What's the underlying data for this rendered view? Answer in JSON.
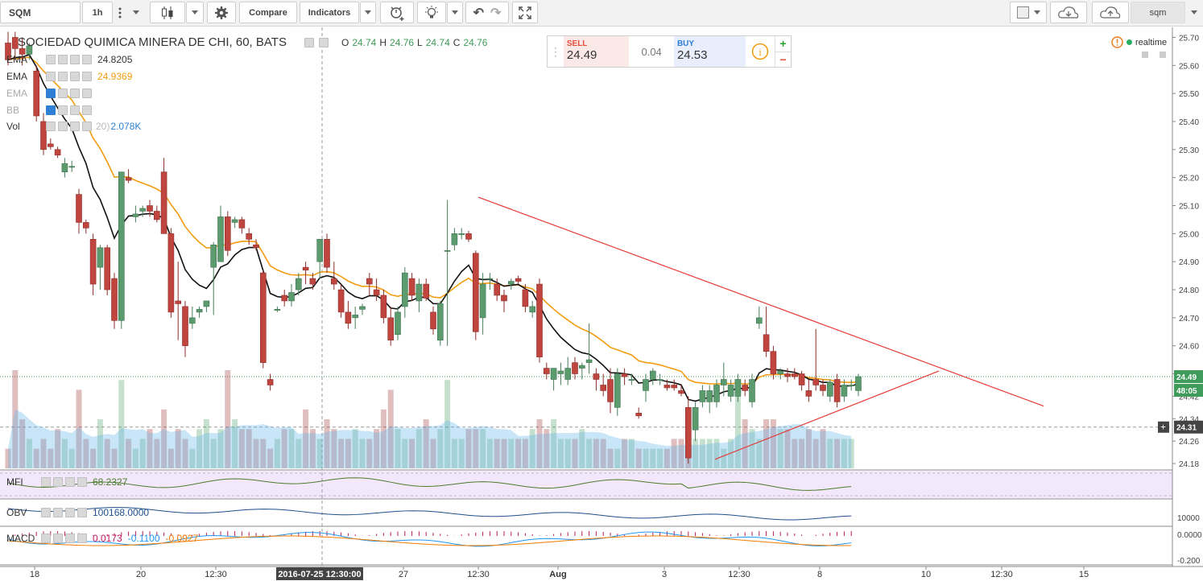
{
  "toolbar": {
    "symbol": "SQM",
    "interval": "1h",
    "compare_label": "Compare",
    "indicators_label": "Indicators",
    "right_symbol": "sqm"
  },
  "chart_header": {
    "title": "SOCIEDAD QUIMICA MINERA DE CHI, 60, BATS",
    "o_label": "O",
    "o": "24.74",
    "h_label": "H",
    "h": "24.76",
    "l_label": "L",
    "l": "24.74",
    "c_label": "C",
    "c": "24.76"
  },
  "studies": [
    {
      "name": "EMA",
      "value": "24.8205",
      "color": "#333333"
    },
    {
      "name": "EMA",
      "value": "24.9369",
      "color": "#f39c12"
    },
    {
      "name": "EMA",
      "value": "",
      "color": "#999999"
    },
    {
      "name": "BB",
      "value": "",
      "color": "#999999"
    },
    {
      "name": "Vol",
      "value": "2.078K",
      "color": "#2f7fd4",
      "faded": "20)"
    }
  ],
  "trade_panel": {
    "sell_label": "SELL",
    "sell_price": "24.49",
    "spread": "0.04",
    "buy_label": "BUY",
    "buy_price": "24.53",
    "plus": "+",
    "minus": "−"
  },
  "realtime_label": "realtime",
  "price_axis": {
    "ticks": [
      "25.70",
      "25.60",
      "25.50",
      "25.40",
      "25.30",
      "25.20",
      "25.10",
      "25.00",
      "24.90",
      "24.80",
      "24.70",
      "24.60",
      "24.50",
      "24.42",
      "24.34",
      "24.26",
      "24.18"
    ],
    "current_price": "24.49",
    "countdown": "48:05",
    "crosshair_price": "24.31"
  },
  "time_axis": {
    "ticks": [
      "18",
      "20",
      "12:30",
      "27",
      "12:30",
      "Aug",
      "3",
      "12:30",
      "8",
      "10",
      "12:30",
      "15"
    ],
    "crosshair_label": "2016-07-25 12:30:00"
  },
  "mfi": {
    "name": "MFI",
    "value": "68.2327",
    "color": "#4a7d2a"
  },
  "obv": {
    "name": "OBV",
    "value": "100168.0000",
    "axis_label": "10000",
    "color": "#1f4e8c"
  },
  "macd": {
    "name": "MACD",
    "hist": "0.0173",
    "macd": "-0.1100",
    "signal": "-0.0927",
    "axis_top": "0.0000",
    "axis_bottom": "-0.200"
  },
  "chart_data": {
    "type": "candlestick",
    "ylim": [
      24.16,
      25.73
    ],
    "candles": [
      [
        25.68,
        25.72,
        25.6,
        25.62
      ],
      [
        25.7,
        25.72,
        25.62,
        25.66
      ],
      [
        25.66,
        25.7,
        25.6,
        25.64
      ],
      [
        25.64,
        25.68,
        25.62,
        25.67
      ],
      [
        25.58,
        25.6,
        25.4,
        25.42
      ],
      [
        25.4,
        25.43,
        25.28,
        25.3
      ],
      [
        25.32,
        25.34,
        25.3,
        25.31
      ],
      [
        25.3,
        25.31,
        25.27,
        25.28
      ],
      [
        25.22,
        25.27,
        25.2,
        25.25
      ],
      [
        25.24,
        25.26,
        25.22,
        25.24
      ],
      [
        25.14,
        25.16,
        25.0,
        25.04
      ],
      [
        25.04,
        25.05,
        25.0,
        25.02
      ],
      [
        24.98,
        25.0,
        24.78,
        24.82
      ],
      [
        24.88,
        24.96,
        24.8,
        24.95
      ],
      [
        24.95,
        24.96,
        24.78,
        24.8
      ],
      [
        24.84,
        24.86,
        24.66,
        24.69
      ],
      [
        24.69,
        25.22,
        24.66,
        25.22
      ],
      [
        25.2,
        25.23,
        25.18,
        25.19
      ],
      [
        25.06,
        25.1,
        25.04,
        25.07
      ],
      [
        25.08,
        25.1,
        25.06,
        25.09
      ],
      [
        25.1,
        25.12,
        25.06,
        25.08
      ],
      [
        25.08,
        25.1,
        25.04,
        25.05
      ],
      [
        25.22,
        25.27,
        25.0,
        25.0
      ],
      [
        25.0,
        25.02,
        24.7,
        24.72
      ],
      [
        24.76,
        24.9,
        24.62,
        24.75
      ],
      [
        24.74,
        24.76,
        24.56,
        24.6
      ],
      [
        24.68,
        24.74,
        24.66,
        24.7
      ],
      [
        24.72,
        24.74,
        24.7,
        24.73
      ],
      [
        24.74,
        24.76,
        24.72,
        24.76
      ],
      [
        24.88,
        24.97,
        24.71,
        24.96
      ],
      [
        24.9,
        25.1,
        24.9,
        25.06
      ],
      [
        25.06,
        25.08,
        24.92,
        24.94
      ],
      [
        25.04,
        25.06,
        25.02,
        25.05
      ],
      [
        25.05,
        25.06,
        25.0,
        25.02
      ],
      [
        25.0,
        25.02,
        24.96,
        24.98
      ],
      [
        24.96,
        24.98,
        24.94,
        24.95
      ],
      [
        24.86,
        24.87,
        24.52,
        24.54
      ],
      [
        24.48,
        24.5,
        24.44,
        24.46
      ],
      [
        24.73,
        24.74,
        24.72,
        24.73
      ],
      [
        24.78,
        24.8,
        24.74,
        24.76
      ],
      [
        24.76,
        24.82,
        24.74,
        24.79
      ],
      [
        24.8,
        24.86,
        24.78,
        24.84
      ],
      [
        24.88,
        24.9,
        24.82,
        24.87
      ],
      [
        24.84,
        24.86,
        24.8,
        24.82
      ],
      [
        24.9,
        24.98,
        24.84,
        24.98
      ],
      [
        24.98,
        25.0,
        24.86,
        24.88
      ],
      [
        24.84,
        24.9,
        24.8,
        24.82
      ],
      [
        24.8,
        24.82,
        24.7,
        24.72
      ],
      [
        24.72,
        24.76,
        24.66,
        24.68
      ],
      [
        24.7,
        24.74,
        24.66,
        24.71
      ],
      [
        24.73,
        24.75,
        24.71,
        24.74
      ],
      [
        24.84,
        24.86,
        24.78,
        24.82
      ],
      [
        24.8,
        24.84,
        24.76,
        24.78
      ],
      [
        24.78,
        24.8,
        24.68,
        24.7
      ],
      [
        24.7,
        24.74,
        24.6,
        24.62
      ],
      [
        24.64,
        24.74,
        24.62,
        24.72
      ],
      [
        24.74,
        24.88,
        24.7,
        24.86
      ],
      [
        24.84,
        24.86,
        24.76,
        24.78
      ],
      [
        24.76,
        24.84,
        24.72,
        24.82
      ],
      [
        24.82,
        24.84,
        24.76,
        24.77
      ],
      [
        24.72,
        24.74,
        24.64,
        24.66
      ],
      [
        24.62,
        24.76,
        24.6,
        24.75
      ],
      [
        24.94,
        25.12,
        24.6,
        24.94
      ],
      [
        24.96,
        25.02,
        24.94,
        25.0
      ],
      [
        25.0,
        25.02,
        24.98,
        25.0
      ],
      [
        25.0,
        25.01,
        24.97,
        24.98
      ],
      [
        24.93,
        24.94,
        24.62,
        24.65
      ],
      [
        24.7,
        24.86,
        24.64,
        24.82
      ],
      [
        24.84,
        24.86,
        24.8,
        24.84
      ],
      [
        24.82,
        24.84,
        24.76,
        24.78
      ],
      [
        24.78,
        24.8,
        24.72,
        24.76
      ],
      [
        24.82,
        24.84,
        24.8,
        24.83
      ],
      [
        24.84,
        24.85,
        24.82,
        24.83
      ],
      [
        24.8,
        24.82,
        24.72,
        24.74
      ],
      [
        24.72,
        24.76,
        24.7,
        24.74
      ],
      [
        24.82,
        24.84,
        24.54,
        24.56
      ],
      [
        24.52,
        24.54,
        24.48,
        24.5
      ],
      [
        24.48,
        24.52,
        24.44,
        24.52
      ],
      [
        24.5,
        24.54,
        24.46,
        24.51
      ],
      [
        24.48,
        24.56,
        24.46,
        24.52
      ],
      [
        24.54,
        24.56,
        24.48,
        24.5
      ],
      [
        24.52,
        24.54,
        24.48,
        24.53
      ],
      [
        24.54,
        24.68,
        24.5,
        24.55
      ],
      [
        24.5,
        24.52,
        24.44,
        24.48
      ],
      [
        24.46,
        24.5,
        24.42,
        24.44
      ],
      [
        24.48,
        24.52,
        24.36,
        24.4
      ],
      [
        24.38,
        24.52,
        24.35,
        24.5
      ],
      [
        24.5,
        24.52,
        24.46,
        24.49
      ],
      [
        24.48,
        24.5,
        24.46,
        24.48
      ],
      [
        24.36,
        24.38,
        24.34,
        24.35
      ],
      [
        24.44,
        24.5,
        24.4,
        24.48
      ],
      [
        24.48,
        24.52,
        24.46,
        24.51
      ],
      [
        24.48,
        24.5,
        24.46,
        24.48
      ],
      [
        24.46,
        24.48,
        24.44,
        24.45
      ],
      [
        24.46,
        24.48,
        24.44,
        24.45
      ],
      [
        24.44,
        24.46,
        24.42,
        24.43
      ],
      [
        24.38,
        24.42,
        24.18,
        24.2
      ],
      [
        24.3,
        24.4,
        24.26,
        24.38
      ],
      [
        24.4,
        24.46,
        24.38,
        24.44
      ],
      [
        24.4,
        24.46,
        24.36,
        24.44
      ],
      [
        24.4,
        24.48,
        24.38,
        24.46
      ],
      [
        24.46,
        24.54,
        24.42,
        24.48
      ],
      [
        24.42,
        24.48,
        24.4,
        24.46
      ],
      [
        24.42,
        24.5,
        24.4,
        24.48
      ],
      [
        24.46,
        24.48,
        24.42,
        24.44
      ],
      [
        24.4,
        24.5,
        24.38,
        24.48
      ],
      [
        24.68,
        24.74,
        24.66,
        24.7
      ],
      [
        24.64,
        24.74,
        24.56,
        24.58
      ],
      [
        24.58,
        24.6,
        24.48,
        24.5
      ],
      [
        24.5,
        24.52,
        24.48,
        24.51
      ],
      [
        24.5,
        24.52,
        24.47,
        24.49
      ],
      [
        24.5,
        24.52,
        24.48,
        24.49
      ],
      [
        24.5,
        24.51,
        24.44,
        24.46
      ],
      [
        24.44,
        24.48,
        24.4,
        24.42
      ],
      [
        24.48,
        24.66,
        24.44,
        24.46
      ],
      [
        24.46,
        24.48,
        24.42,
        24.44
      ],
      [
        24.42,
        24.48,
        24.4,
        24.47
      ],
      [
        24.48,
        24.5,
        24.38,
        24.4
      ],
      [
        24.42,
        24.48,
        24.4,
        24.46
      ],
      [
        24.46,
        24.48,
        24.44,
        24.46
      ],
      [
        24.44,
        24.5,
        24.42,
        24.49
      ]
    ],
    "volume": [
      2,
      10,
      5,
      3,
      2,
      3,
      2,
      4,
      3,
      2,
      8,
      3,
      2,
      5,
      3,
      2,
      9,
      3,
      2,
      3,
      4,
      3,
      6,
      2,
      4,
      3,
      2,
      4,
      5,
      3,
      4,
      10,
      5,
      4,
      4,
      3,
      3,
      2,
      3,
      4,
      4,
      3,
      6,
      4,
      3,
      5,
      4,
      3,
      3,
      4,
      3,
      3,
      4,
      6,
      8,
      4,
      3,
      3,
      4,
      5,
      3,
      4,
      9,
      3,
      3,
      4,
      4,
      4,
      3,
      3,
      3,
      3,
      3,
      3,
      4,
      5,
      4,
      5,
      3,
      3,
      3,
      4,
      3,
      3,
      3,
      2,
      2,
      3,
      3,
      2,
      2,
      2,
      2,
      2,
      3,
      3,
      2,
      3,
      3,
      3,
      3,
      2,
      3,
      9,
      5,
      4,
      3,
      5,
      5,
      4,
      4,
      3,
      3,
      4,
      3,
      4,
      3,
      3,
      3,
      3
    ]
  }
}
